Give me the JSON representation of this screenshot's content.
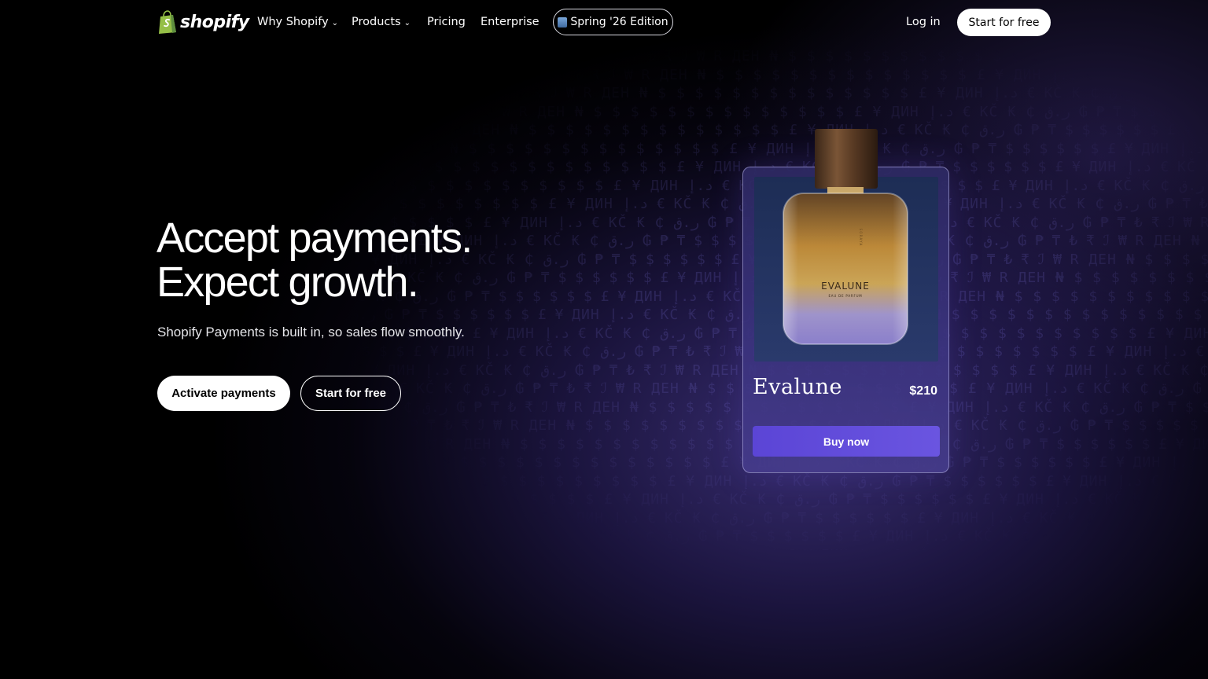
{
  "nav": {
    "logo_text": "shopify",
    "items": [
      {
        "label": "Why Shopify",
        "has_dropdown": true
      },
      {
        "label": "Products",
        "has_dropdown": true
      },
      {
        "label": "Pricing",
        "has_dropdown": false
      },
      {
        "label": "Enterprise",
        "has_dropdown": false
      }
    ],
    "edition_label": "Spring '26 Edition",
    "login_label": "Log in",
    "cta_label": "Start for free"
  },
  "hero": {
    "title_line1": "Accept payments.",
    "title_line2": "Expect growth.",
    "subtitle": "Shopify Payments is built in, so sales flow smoothly.",
    "primary_button": "Activate payments",
    "secondary_button": "Start for free"
  },
  "product_card": {
    "name": "Evalune",
    "price": "$210",
    "buy_label": "Buy now",
    "bottle_label": "EVALUNE",
    "bottle_sublabel": "EAU DE PARFUM",
    "bottle_brand": "SORAYA"
  },
  "background": {
    "currency_pattern": "$ $ $ $ $ $ £ ¥ ДИН د.إ € KČ ₭ ₵ ر.ق ₲ ₱ ₸ ₺ ₹ ℐ ₩ R ДЕН ₦ $ $ $ $ $ $ $ $ $ $ $ $ $ $ £ ¥ ДИН د.إ € KČ ₭ ₵ ر.ق ₲ ₱ ₸ "
  },
  "colors": {
    "accent": "#6a55e0",
    "background": "#000000",
    "card_border": "#bebaeb"
  },
  "icons": {
    "logo": "shopify-bag-icon",
    "dropdown": "chevron-down-icon",
    "edition": "shopping-bag-icon"
  }
}
